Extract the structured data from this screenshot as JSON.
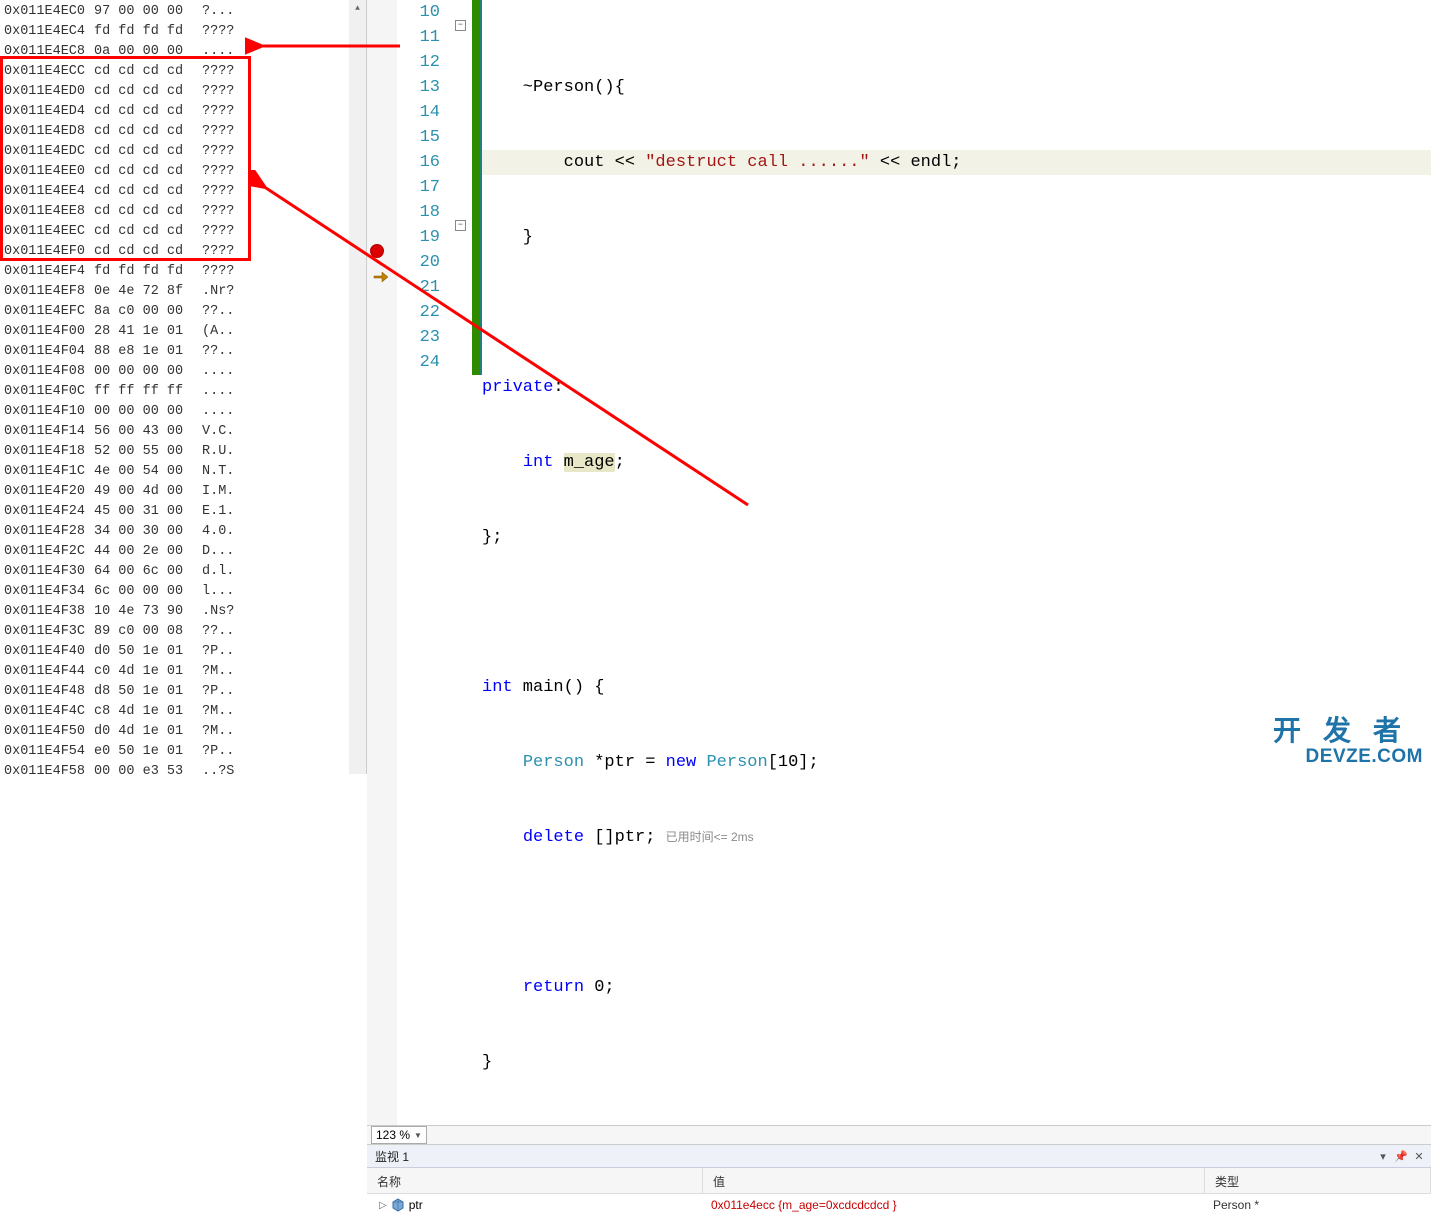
{
  "memory": {
    "rows": [
      {
        "addr": "0x011E4EC0",
        "hex": "97 00 00 00",
        "ascii": "?..."
      },
      {
        "addr": "0x011E4EC4",
        "hex": "fd fd fd fd",
        "ascii": "????"
      },
      {
        "addr": "0x011E4EC8",
        "hex": "0a 00 00 00",
        "ascii": "...."
      },
      {
        "addr": "0x011E4ECC",
        "hex": "cd cd cd cd",
        "ascii": "????"
      },
      {
        "addr": "0x011E4ED0",
        "hex": "cd cd cd cd",
        "ascii": "????"
      },
      {
        "addr": "0x011E4ED4",
        "hex": "cd cd cd cd",
        "ascii": "????"
      },
      {
        "addr": "0x011E4ED8",
        "hex": "cd cd cd cd",
        "ascii": "????"
      },
      {
        "addr": "0x011E4EDC",
        "hex": "cd cd cd cd",
        "ascii": "????"
      },
      {
        "addr": "0x011E4EE0",
        "hex": "cd cd cd cd",
        "ascii": "????"
      },
      {
        "addr": "0x011E4EE4",
        "hex": "cd cd cd cd",
        "ascii": "????"
      },
      {
        "addr": "0x011E4EE8",
        "hex": "cd cd cd cd",
        "ascii": "????"
      },
      {
        "addr": "0x011E4EEC",
        "hex": "cd cd cd cd",
        "ascii": "????"
      },
      {
        "addr": "0x011E4EF0",
        "hex": "cd cd cd cd",
        "ascii": "????"
      },
      {
        "addr": "0x011E4EF4",
        "hex": "fd fd fd fd",
        "ascii": "????"
      },
      {
        "addr": "0x011E4EF8",
        "hex": "0e 4e 72 8f",
        "ascii": ".Nr?"
      },
      {
        "addr": "0x011E4EFC",
        "hex": "8a c0 00 00",
        "ascii": "??.."
      },
      {
        "addr": "0x011E4F00",
        "hex": "28 41 1e 01",
        "ascii": "(A.."
      },
      {
        "addr": "0x011E4F04",
        "hex": "88 e8 1e 01",
        "ascii": "??.."
      },
      {
        "addr": "0x011E4F08",
        "hex": "00 00 00 00",
        "ascii": "...."
      },
      {
        "addr": "0x011E4F0C",
        "hex": "ff ff ff ff",
        "ascii": "...."
      },
      {
        "addr": "0x011E4F10",
        "hex": "00 00 00 00",
        "ascii": "...."
      },
      {
        "addr": "0x011E4F14",
        "hex": "56 00 43 00",
        "ascii": "V.C."
      },
      {
        "addr": "0x011E4F18",
        "hex": "52 00 55 00",
        "ascii": "R.U."
      },
      {
        "addr": "0x011E4F1C",
        "hex": "4e 00 54 00",
        "ascii": "N.T."
      },
      {
        "addr": "0x011E4F20",
        "hex": "49 00 4d 00",
        "ascii": "I.M."
      },
      {
        "addr": "0x011E4F24",
        "hex": "45 00 31 00",
        "ascii": "E.1."
      },
      {
        "addr": "0x011E4F28",
        "hex": "34 00 30 00",
        "ascii": "4.0."
      },
      {
        "addr": "0x011E4F2C",
        "hex": "44 00 2e 00",
        "ascii": "D..."
      },
      {
        "addr": "0x011E4F30",
        "hex": "64 00 6c 00",
        "ascii": "d.l."
      },
      {
        "addr": "0x011E4F34",
        "hex": "6c 00 00 00",
        "ascii": "l..."
      },
      {
        "addr": "0x011E4F38",
        "hex": "10 4e 73 90",
        "ascii": ".Ns?"
      },
      {
        "addr": "0x011E4F3C",
        "hex": "89 c0 00 08",
        "ascii": "??.."
      },
      {
        "addr": "0x011E4F40",
        "hex": "d0 50 1e 01",
        "ascii": "?P.."
      },
      {
        "addr": "0x011E4F44",
        "hex": "c0 4d 1e 01",
        "ascii": "?M.."
      },
      {
        "addr": "0x011E4F48",
        "hex": "d8 50 1e 01",
        "ascii": "?P.."
      },
      {
        "addr": "0x011E4F4C",
        "hex": "c8 4d 1e 01",
        "ascii": "?M.."
      },
      {
        "addr": "0x011E4F50",
        "hex": "d0 4d 1e 01",
        "ascii": "?M.."
      },
      {
        "addr": "0x011E4F54",
        "hex": "e0 50 1e 01",
        "ascii": "?P.."
      },
      {
        "addr": "0x011E4F58",
        "hex": "00 00 e3 53",
        "ascii": "..?S"
      }
    ]
  },
  "editor": {
    "zoom": "123 %",
    "lines": [
      {
        "n": 10
      },
      {
        "n": 11
      },
      {
        "n": 12
      },
      {
        "n": 13
      },
      {
        "n": 14
      },
      {
        "n": 15
      },
      {
        "n": 16
      },
      {
        "n": 17
      },
      {
        "n": 18
      },
      {
        "n": 19
      },
      {
        "n": 20
      },
      {
        "n": 21
      },
      {
        "n": 22
      },
      {
        "n": 23
      },
      {
        "n": 24
      }
    ],
    "code": {
      "l10": "    ~Person(){",
      "l11": "        cout << \"destruct call ......\" << endl;",
      "l12": "    }",
      "l13": "",
      "l14": "private:",
      "l15_a": "    ",
      "l15_b": "int",
      "l15_c": " ",
      "l15_d": "m_age",
      "l15_e": ";",
      "l16": "};",
      "l17": "",
      "l18_a": "int",
      "l18_b": " main() {",
      "l19_a": "    ",
      "l19_b": "Person",
      "l19_c": " *ptr = ",
      "l19_d": "new",
      "l19_e": " ",
      "l19_f": "Person",
      "l19_g": "[10];",
      "l20_a": "    ",
      "l20_b": "delete",
      "l20_c": " []ptr; ",
      "l20_hint": "已用时间<= 2ms",
      "l21": "",
      "l22_a": "    ",
      "l22_b": "return",
      "l22_c": " 0;",
      "l23": "}"
    }
  },
  "watch": {
    "title": "监视 1",
    "columns": {
      "name": "名称",
      "value": "值",
      "type": "类型"
    },
    "row": {
      "name": "ptr",
      "value": "0x011e4ecc {m_age=0xcdcdcdcd }",
      "type": "Person *"
    }
  },
  "watermark": {
    "top": "开发者",
    "bot": "DEVZE.COM"
  }
}
